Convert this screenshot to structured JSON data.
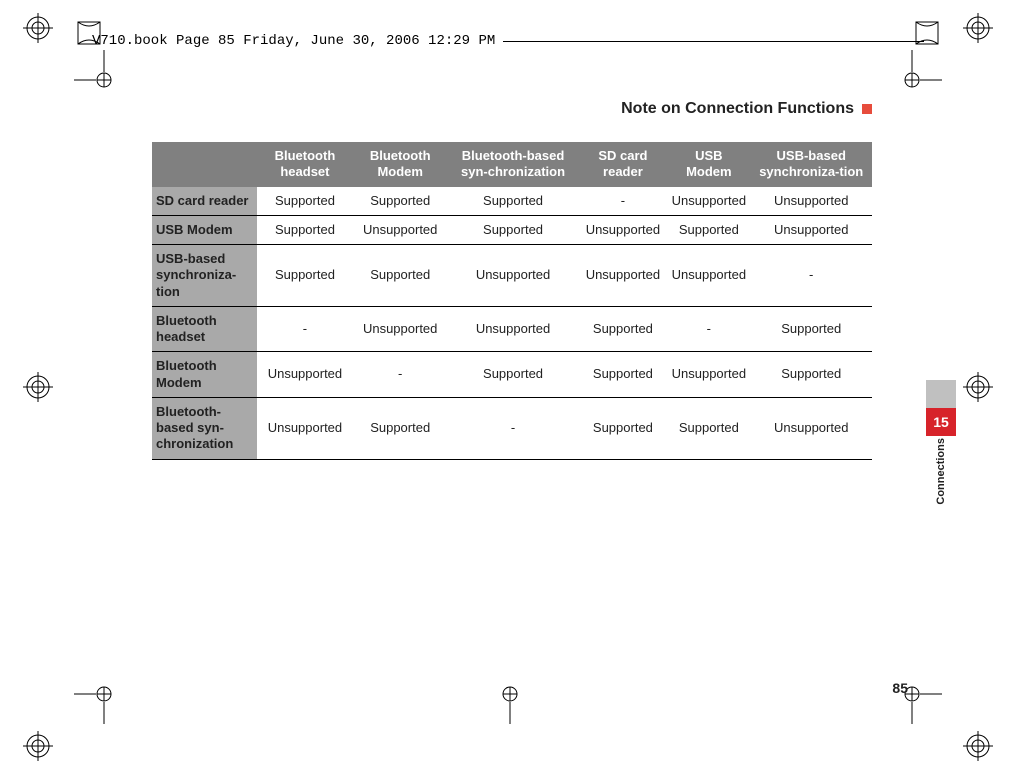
{
  "header": {
    "filename_line": "V710.book  Page 85  Friday, June 30, 2006  12:29 PM"
  },
  "title": "Note on Connection Functions",
  "chapter_number": "15",
  "chapter_name": "Connections",
  "page_number": "85",
  "table": {
    "columns": [
      "Bluetooth headset",
      "Bluetooth Modem",
      "Bluetooth-based syn-chronization",
      "SD card reader",
      "USB Modem",
      "USB-based synchroniza-tion"
    ],
    "rows": [
      {
        "label": "SD card reader",
        "cells": [
          "Supported",
          "Supported",
          "Supported",
          "-",
          "Unsupported",
          "Unsupported"
        ]
      },
      {
        "label": "USB Modem",
        "cells": [
          "Supported",
          "Unsupported",
          "Supported",
          "Unsupported",
          "Supported",
          "Unsupported"
        ]
      },
      {
        "label": "USB-based synchroniza-tion",
        "cells": [
          "Supported",
          "Supported",
          "Unsupported",
          "Unsupported",
          "Unsupported",
          "-"
        ]
      },
      {
        "label": "Bluetooth headset",
        "cells": [
          "-",
          "Unsupported",
          "Unsupported",
          "Supported",
          "-",
          "Supported"
        ]
      },
      {
        "label": "Bluetooth Modem",
        "cells": [
          "Unsupported",
          "-",
          "Supported",
          "Supported",
          "Unsupported",
          "Supported"
        ]
      },
      {
        "label": "Bluetooth-based syn-chronization",
        "cells": [
          "Unsupported",
          "Supported",
          "-",
          "Supported",
          "Supported",
          "Unsupported"
        ]
      }
    ]
  }
}
